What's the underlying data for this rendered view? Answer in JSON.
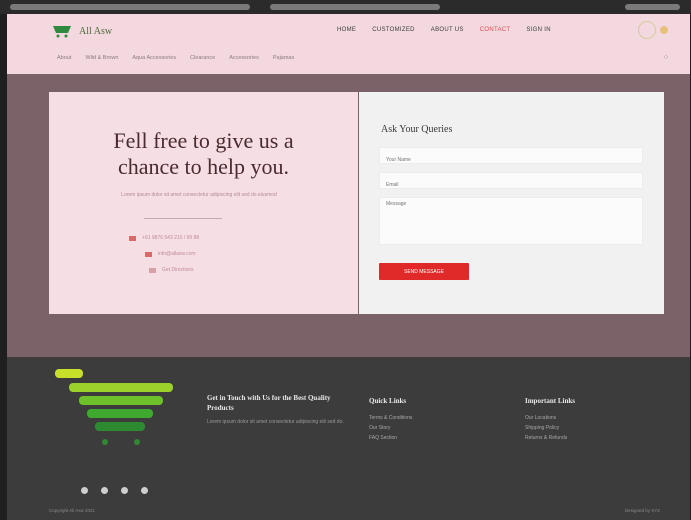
{
  "header": {
    "logo_text": "All Asw",
    "nav": [
      "HOME",
      "CUSTOMIZED",
      "ABOUT US",
      "CONTACT",
      "SIGN IN"
    ],
    "sub_nav": [
      "About",
      "Wild & Brown",
      "Aqua Accessories",
      "Clearance",
      "Accessories",
      "Pajamas"
    ]
  },
  "contact": {
    "headline_line1": "Fell free to give us a",
    "headline_line2": "chance to help you.",
    "tagline": "Lorem ipsum dolor sit amet consectetur adipiscing elit sed do eiusmod",
    "info": [
      "+91 9876 543 210 / 99 88",
      "info@allasw.com",
      "Get Directions"
    ],
    "form_title": "Ask Your Queries",
    "name_placeholder": "Your Name",
    "email_placeholder": "Email",
    "message_placeholder": "Message",
    "submit_label": "SEND MESSAGE"
  },
  "footer": {
    "about_heading": "Get in Touch with Us for the Best Quality Products",
    "about_text": "Lorem ipsum dolor sit amet consectetur adipiscing elit sed do.",
    "quick_links_heading": "Quick Links",
    "quick_links": [
      "Terms & Conditions",
      "Our Story",
      "FAQ Section"
    ],
    "important_links_heading": "Important Links",
    "important_links": [
      "Our Locations",
      "Shipping Policy",
      "Returns & Refunds"
    ],
    "socials": [
      "facebook-icon",
      "twitter-icon",
      "instagram-icon",
      "youtube-icon"
    ],
    "copyright": "Copyright All Asw 2021",
    "credit": "Designed by XYZ"
  },
  "colors": {
    "header_bg": "#f3d9df",
    "band_bg": "#7a6268",
    "accent_red": "#e02a2a",
    "footer_bg": "#3c3c3c",
    "brand_green": "#4a6b3a"
  }
}
